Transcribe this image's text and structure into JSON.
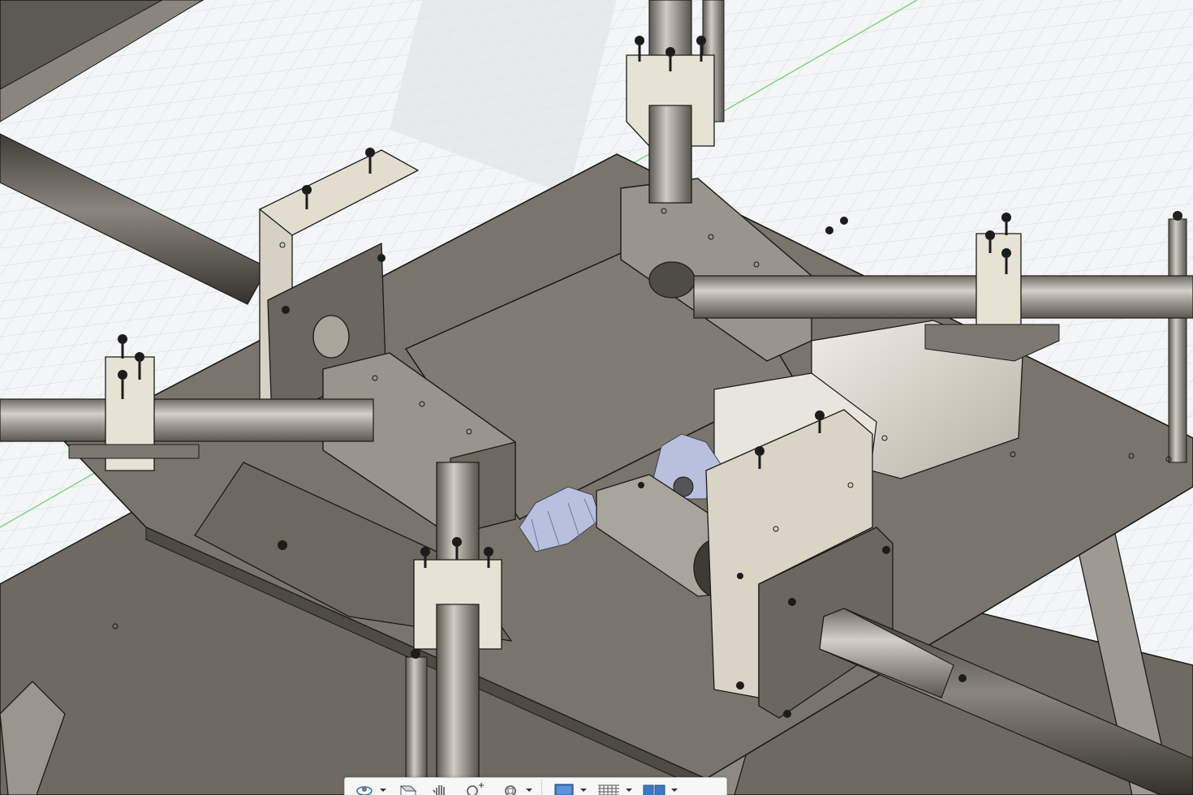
{
  "toolbar": {
    "items": [
      {
        "name": "orbit",
        "icon": "orbit-icon",
        "has_menu": true
      },
      {
        "name": "look-at",
        "icon": "look-at-icon",
        "has_menu": false
      },
      {
        "name": "pan",
        "icon": "pan-hand-icon",
        "has_menu": false
      },
      {
        "name": "zoom",
        "icon": "zoom-icon",
        "has_menu": false
      },
      {
        "name": "fit",
        "icon": "fit-icon",
        "has_menu": true
      },
      {
        "name": "display-settings",
        "icon": "display-settings-icon",
        "has_menu": true
      },
      {
        "name": "grid-snaps",
        "icon": "grid-icon",
        "has_menu": true
      },
      {
        "name": "viewports",
        "icon": "viewports-icon",
        "has_menu": true
      }
    ]
  },
  "colors": {
    "grid_background": "#f4f5f6",
    "grid_line": "#d2d6da",
    "axis_green": "#5fd35f",
    "plate_metal": "#7a756c",
    "tube_metal": "#a8a49c",
    "clamp_ivory": "#e6e2d4",
    "gear_blue": "#b8c0de",
    "edge_dark": "#1a1a1a"
  }
}
